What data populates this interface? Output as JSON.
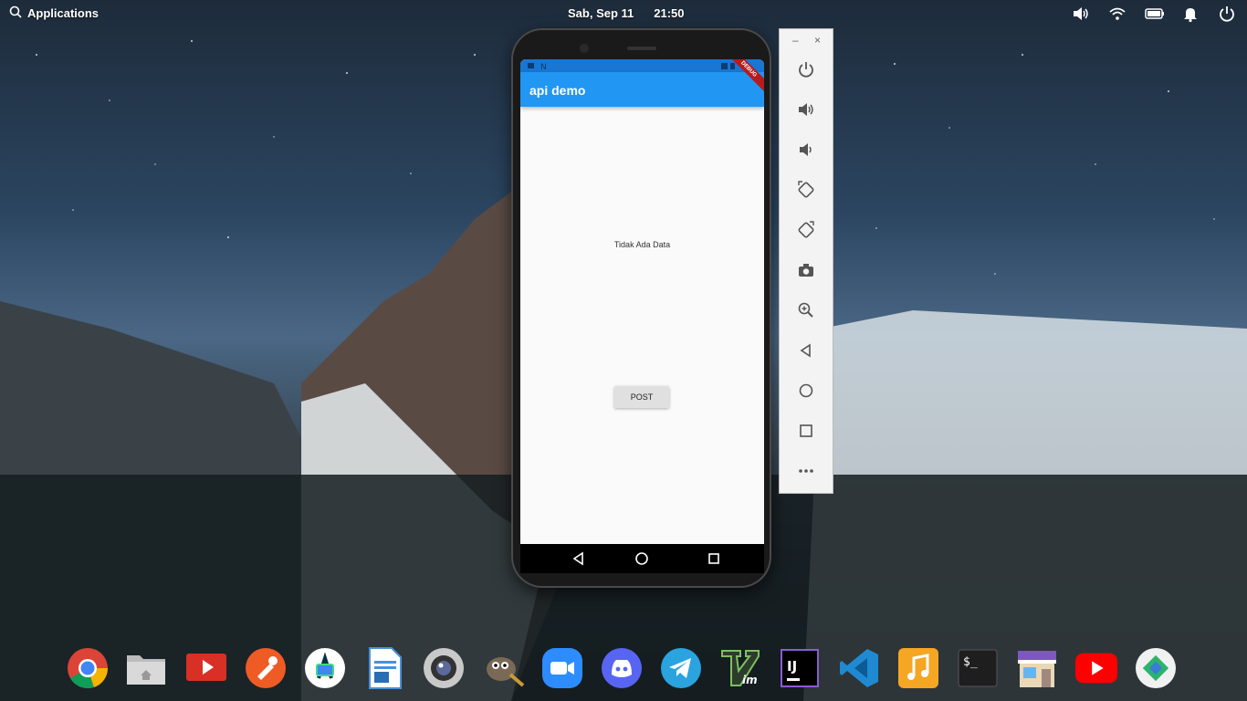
{
  "top_panel": {
    "applications_label": "Applications",
    "date": "Sab, Sep 11",
    "time": "21:50"
  },
  "phone": {
    "app_title": "api demo",
    "debug_banner": "DEBUG",
    "empty_message": "Tidak Ada Data",
    "post_button": "POST"
  },
  "emulator_toolbar": {
    "minimize": "–",
    "close": "×"
  },
  "dock": {
    "apps": [
      "chrome-icon",
      "files-icon",
      "video-player-icon",
      "postman-icon",
      "android-studio-icon",
      "libreoffice-writer-icon",
      "webcam-icon",
      "gimp-icon",
      "zoom-icon",
      "discord-icon",
      "telegram-icon",
      "vim-icon",
      "intellij-icon",
      "vscode-icon",
      "music-icon",
      "terminal-icon",
      "appcenter-icon",
      "youtube-icon",
      "screenshot-icon"
    ]
  },
  "colors": {
    "appbar": "#2196f3",
    "statusbar": "#1976d2"
  }
}
